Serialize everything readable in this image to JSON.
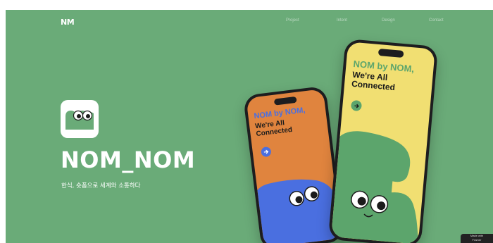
{
  "header": {
    "logo": "NM",
    "nav": [
      "Project",
      "Intent",
      "Design",
      "Contact"
    ]
  },
  "hero": {
    "app_name": "NOM_NOM",
    "tagline": "한식, 숏폼으로 세계와 소통하다"
  },
  "phone_back": {
    "title": "NOM by NOM,",
    "subtitle": "We're All Connected"
  },
  "phone_front": {
    "title": "NOM by NOM,",
    "subtitle": "We're All Connected"
  },
  "badge": "Made with\nFramer",
  "colors": {
    "background": "#6aab78",
    "orange": "#e0843e",
    "yellow": "#f1df72",
    "blue": "#4a6fe0"
  }
}
